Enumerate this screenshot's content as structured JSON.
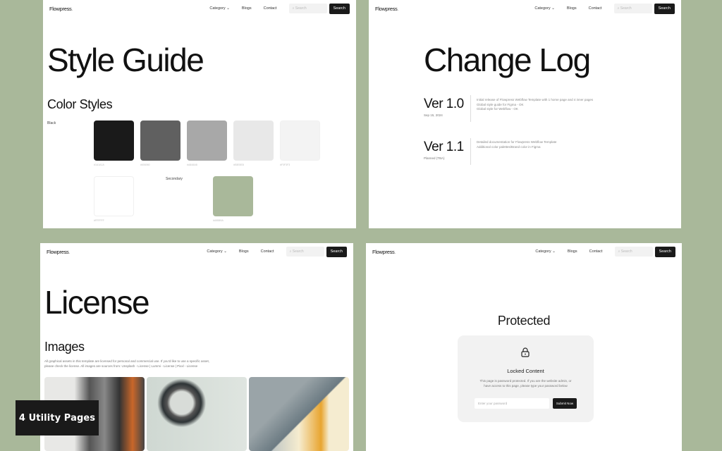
{
  "nav": {
    "logo": "Flowpress",
    "logo_dot": ".",
    "category": "Category",
    "blogs": "Blogs",
    "contact": "Contact",
    "search_placeholder": "Search",
    "search_button": "Search"
  },
  "style_guide": {
    "title": "Style Guide",
    "section": "Color Styles",
    "black_label": "Black",
    "secondary_label": "Secondary",
    "swatches": [
      {
        "color": "#1a1a1a",
        "hex": "#1A1A1A"
      },
      {
        "color": "#606060",
        "hex": "#606060"
      },
      {
        "color": "#a8a8a8",
        "hex": "#A8A8A8"
      },
      {
        "color": "#e8e8e8",
        "hex": "#E8E8E8"
      },
      {
        "color": "#f3f3f3",
        "hex": "#F3F3F3"
      },
      {
        "color": "#ffffff",
        "hex": "#FFFFFF"
      }
    ],
    "secondary": {
      "color": "#a9b89a",
      "hex": "#A9B89A"
    }
  },
  "change_log": {
    "title": "Change Log",
    "entries": [
      {
        "version": "Ver 1.0",
        "date": "Sep 15, 2024",
        "notes": [
          "Initial release of Flowpress Webflow Template with 1 home page and 4 inner pages",
          "Global style guide for Figma - OK",
          "Global style for Webflow - OK"
        ]
      },
      {
        "version": "Ver 1.1",
        "date": "Planned (TBA)",
        "notes": [
          "Detailed documentation for Flowpress Webflow Template",
          "Additional color palettes/Brand color in Figma"
        ]
      }
    ]
  },
  "license": {
    "title": "License",
    "section": "Images",
    "text1": "All graphical assets in this template are licensed for personal and commercial use. If you'd like to use a specific asset,",
    "text2": "please check the license. All images are sources from: Unsplash - License | Lummi - License | Pixxl - License"
  },
  "protected": {
    "title": "Protected",
    "card_title": "Locked Content",
    "desc1": "This page is password protected. If you are the website admin, or",
    "desc2": "have access to this page, please type your password below",
    "input_placeholder": "Enter your password",
    "submit": "Submit Now"
  },
  "badge": "4 Utility Pages"
}
